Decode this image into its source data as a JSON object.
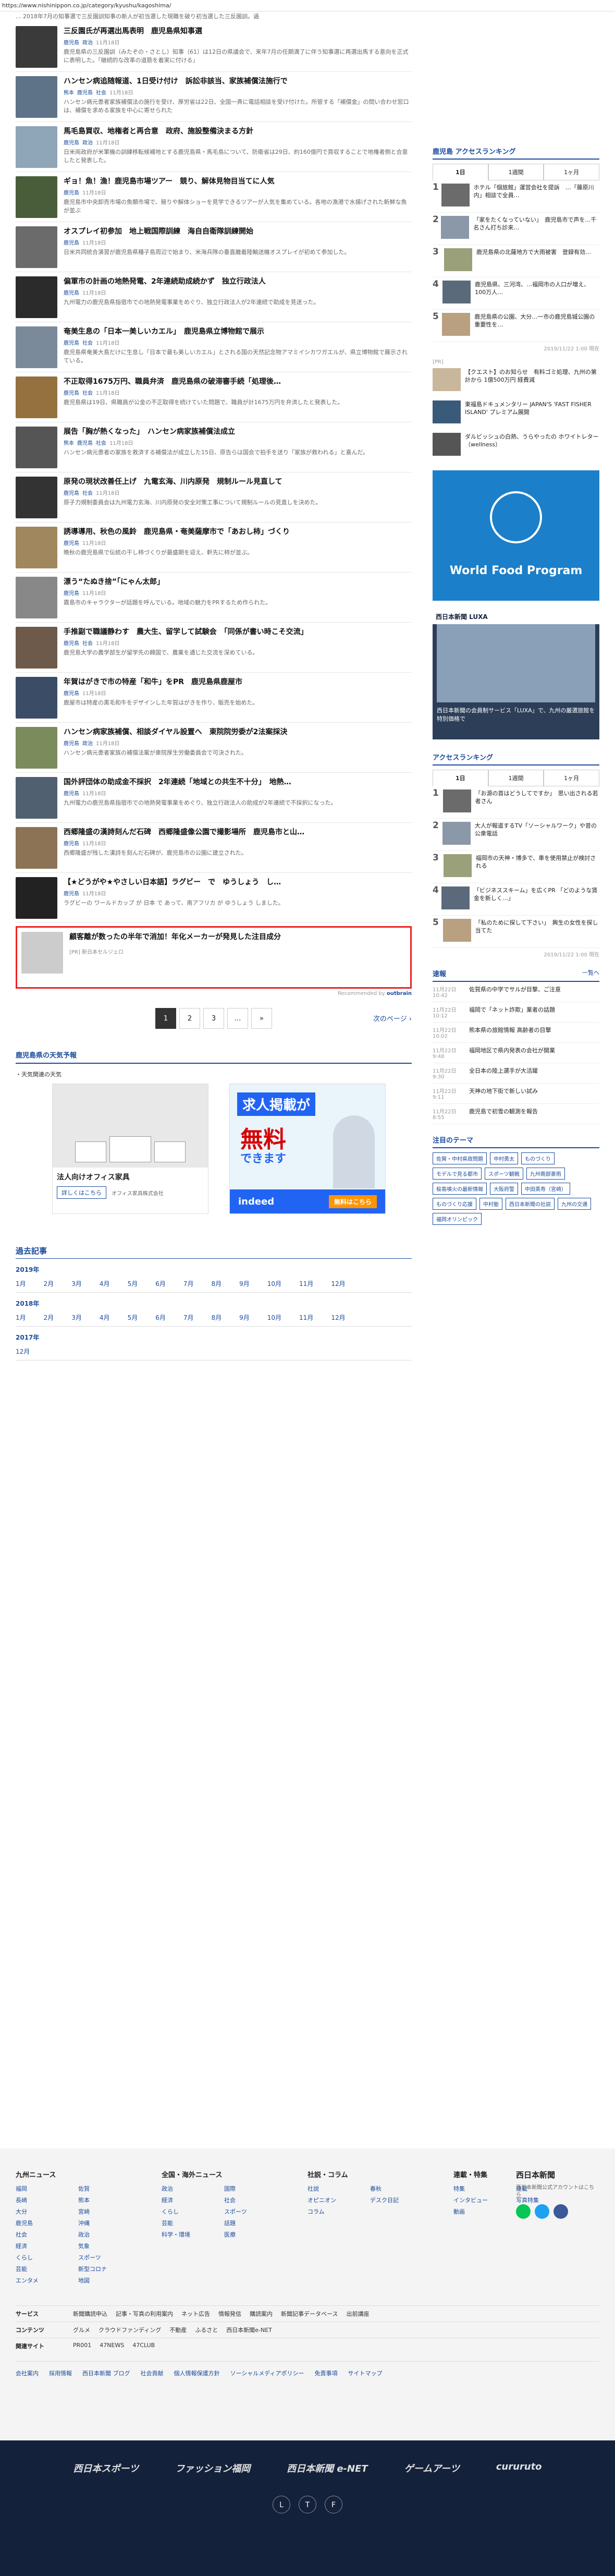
{
  "url": "https://www.nishinippon.co.jp/category/kyushu/kagoshima/",
  "top_snippet": "... 2018年7月の知事選で三反園訓知事の新人が初当選した現職を破り初当選した三反園訓。過",
  "articles": [
    {
      "title": "三反園氏が再選出馬表明　鹿児島県知事選",
      "tags": [
        "鹿児島",
        "政治"
      ],
      "time": "11月18日",
      "desc": "鹿児島県の三反園訓（みたぞの・さとし）知事（61）は12日の県議会で、来年7月の任期満了に伴う知事選に再選出馬する意向を正式に表明した。「継続的な改革の道筋を着実に付ける」"
    },
    {
      "title": "ハンセン病追随報道、1日受け付け　訴訟非該当、家族補償法施行で",
      "tags": [
        "熊本",
        "鹿児島",
        "社会"
      ],
      "time": "11月18日",
      "desc": "ハンセン病元患者家族補償法の施行を受け、厚労省は22日、全国一斉に電話相談を受け付けた。所管する「補償金」の問い合わせ窓口は、補償を求める家族を中心に寄せられた"
    },
    {
      "title": "馬毛島買収、地権者と再合意　政府、施設整備決まる方針",
      "tags": [
        "鹿児島",
        "政治"
      ],
      "time": "11月18日",
      "desc": "日米両政府が米軍機の訓練移転候補地とする鹿児島県・馬毛島について、防衛省は29日、約160億円で買収することで地権者側と合意したと発表した。"
    },
    {
      "title": "ギョ！魚！漁！鹿児島市場ツアー　競り、解体見物目当てに人気",
      "tags": [
        "鹿児島"
      ],
      "time": "11月18日",
      "desc": "鹿児島市中央卸売市場の魚類市場で、競りや解体ショーを見学できるツアーが人気を集めている。各地の漁港で水揚げされた新鮮な魚が並ぶ"
    },
    {
      "title": "オスプレイ初参加　地上戦国際訓練　海自自衛隊訓練開始",
      "tags": [
        "鹿児島"
      ],
      "time": "11月18日",
      "desc": "日米共同統合演習が鹿児島県種子島周辺で始まり、米海兵隊の垂直離着陸輸送機オスプレイが初めて参加した。"
    },
    {
      "title": "偏軍市の計画の地熱発電、2年連続助成続かず　独立行政法人",
      "tags": [
        "鹿児島"
      ],
      "time": "11月18日",
      "desc": "九州電力の鹿児島県指宿市での地熱発電事業をめぐり、独立行政法人が2年連続で助成を見送った。"
    },
    {
      "title": "奄美生息の「日本一美しいカエル」　鹿児島県立博物館で展示",
      "tags": [
        "鹿児島",
        "社会"
      ],
      "time": "11月18日",
      "desc": "鹿児島県奄美大島だけに生息し「日本で最も美しいカエル」とされる国の天然記念物アマミイシカワガエルが、県立博物館で展示されている。"
    },
    {
      "title": "不正取得1675万円、職員弁済　鹿児島県の破滞審手続「処理後…",
      "tags": [
        "鹿児島",
        "社会"
      ],
      "time": "11月18日",
      "desc": "鹿児島県は19日、県職員が公金の不正取得を続けていた問題で、職員が計1675万円を弁済したと発表した。"
    },
    {
      "title": "展告「胸が熱くなった」　ハンセン病家族補償法成立",
      "tags": [
        "熊本",
        "鹿児島",
        "社会"
      ],
      "time": "11月18日",
      "desc": "ハンセン病元患者の家族を救済する補償法が成立した15日、原告らは国会で拍手を送り「家族が救われる」と喜んだ。"
    },
    {
      "title": "原発の現状改善任上げ　九電玄海、川内原発　規制ルール見直して",
      "tags": [
        "鹿児島",
        "社会"
      ],
      "time": "11月18日",
      "desc": "原子力規制委員会は九州電力玄海、川内原発の安全対策工事について規制ルールの見直しを決めた。"
    },
    {
      "title": "誘導導用、秋色の風鈴　鹿児島県・奄美薩摩市で「あおし柿」づくり",
      "tags": [
        "鹿児島"
      ],
      "time": "11月18日",
      "desc": "晩秋の鹿児島県で伝統の干し柿づくりが最盛期を迎え、軒先に柿が並ぶ。"
    },
    {
      "title": "漂う“たぬき捨”「にゃん太郎」",
      "tags": [
        "鹿児島"
      ],
      "time": "11月18日",
      "desc": "霧島市のキャラクターが話題を呼んでいる。地域の魅力をPRするため作られた。"
    },
    {
      "title": "手推副で職議静わす　農大生、留学して試験会　「同係が書い時こそ交流」",
      "tags": [
        "鹿児島",
        "社会"
      ],
      "time": "11月18日",
      "desc": "鹿児島大学の農学部生が留学先の韓国で、農業を通じた交流を深めている。"
    },
    {
      "title": "年賀はがきで市の特産「和牛」をPR　鹿児島県鹿屋市",
      "tags": [
        "鹿児島"
      ],
      "time": "11月18日",
      "desc": "鹿屋市は特産の黒毛和牛をデザインした年賀はがきを作り、販売を始めた。"
    },
    {
      "title": "ハンセン病家族補償、相談ダイヤル設置へ　東院院労委が2法案採決",
      "tags": [
        "鹿児島",
        "政治"
      ],
      "time": "11月18日",
      "desc": "ハンセン病元患者家族の補償法案が衆院厚生労働委員会で可決された。"
    },
    {
      "title": "国外評団体の助成金不採択　2年連続「地域との共生不十分」　地熱…",
      "tags": [
        "鹿児島"
      ],
      "time": "11月18日",
      "desc": "九州電力の鹿児島県指宿市での地熱発電事業をめぐり、独立行政法人の助成が2年連続で不採択になった。"
    },
    {
      "title": "西郷隆盛の漢詩刻んだ石碑　西郷隆盛像公園で撮影場所　鹿児島市と山…",
      "tags": [
        "鹿児島"
      ],
      "time": "11月18日",
      "desc": "西郷隆盛が残した漢詩を刻んだ石碑が、鹿児島市の公園に建立された。"
    },
    {
      "title": "【★どうがや★やさしい日本語】ラグビー　で　ゆうしょう　し…",
      "tags": [
        "鹿児島"
      ],
      "time": "11月18日",
      "desc": "ラグビーの ワールドカップ が 日本 で あって、南アフリカ が ゆうしょう しました。"
    }
  ],
  "pr": {
    "title": "顧客離が数ったの半年で消加！年化メーカーが発見した注目成分",
    "sponsor": "[PR] 新日本セルジェロ"
  },
  "recommended": "Recommended by",
  "pager": {
    "pages": [
      "1",
      "2",
      "3",
      "…",
      "»"
    ],
    "next": "次のページ"
  },
  "ad_section": {
    "title": "鹿児島県の天気予報",
    "sub": "・天気関連の天気",
    "ad1_title": "法人向けオフィス家具",
    "ad1_btn": "詳しくはこちら",
    "ad1_co": "オフィス家具株式会社",
    "ad2_title": "求人掲載が",
    "ad2_big": "無料",
    "ad2_sub": "できます",
    "ad2_brand": "indeed",
    "ad2_btn": "無料はこちら"
  },
  "archive": {
    "title": "過去記事",
    "years": [
      {
        "year": "2019年",
        "months": [
          "1月",
          "2月",
          "3月",
          "4月",
          "5月",
          "6月",
          "7月",
          "8月",
          "9月",
          "10月",
          "11月",
          "12月"
        ]
      },
      {
        "year": "2018年",
        "months": [
          "1月",
          "2月",
          "3月",
          "4月",
          "5月",
          "6月",
          "7月",
          "8月",
          "9月",
          "10月",
          "11月",
          "12月"
        ]
      },
      {
        "year": "2017年",
        "months": [
          "12月"
        ]
      }
    ]
  },
  "side": {
    "rank_title": "鹿児島 アクセスランキング",
    "tabs": [
      "1日",
      "1週間",
      "1ヶ月"
    ],
    "ranking": [
      {
        "n": "1",
        "t": "ホテル「個旅館」運営会社を提訴　…「藤原川内」相談で全員…"
      },
      {
        "n": "2",
        "t": "「家をたくなっていない」　鹿児島市で声を…千名さん打ち診来…"
      },
      {
        "n": "3",
        "t": "鹿児島県の北薩地方で大雨被害　登録有効…"
      },
      {
        "n": "4",
        "t": "鹿児島県、三河湾、…福岡市の人口が増え、100万人…"
      },
      {
        "n": "5",
        "t": "鹿児島県の公園、大分…一市の鹿児島城公園の重要性を…"
      }
    ],
    "stamp1": "2019/11/22 1:00 現在",
    "pr_label": "[PR]",
    "pr_items": [
      {
        "t": "【クエスト】のお知らせ　有料ゴミ処理、九州の第計から 1億500万円 経費減"
      },
      {
        "t": "東福島ドキュメンタリー JAPAN'S 'FAST FISHER ISLAND' プレミアム展開"
      },
      {
        "t": "ダルビッシュの白熱、うらやったの ホワイトレター（wellness）"
      }
    ],
    "wfp": "World Food Program",
    "promo_brand": "西日本新聞 LUXA",
    "promo_text": "西日本新聞の会員制サービス「LUXA」で、九州の厳選旅館を特別価格で",
    "rank2_title": "アクセスランキング",
    "tabs2": [
      "1日",
      "1週間",
      "1ヶ月"
    ],
    "ranking2": [
      {
        "n": "1",
        "t": "「お源の首はどうしてですか」　思い出される若者さん"
      },
      {
        "n": "2",
        "t": "大人が報道するTV「ソーシャルワーク」や昔の公衆電話"
      },
      {
        "n": "3",
        "t": "福岡市の天神・博多で、車を使用禁止が検討される"
      },
      {
        "n": "4",
        "t": "「ビジネススキーム」を広くPR 「どのような賃金を新しく…」"
      },
      {
        "n": "5",
        "t": "「私のために探して下さい」　興生の女性を探し当てた"
      }
    ],
    "stamp2": "2019/11/22 1:00 現在",
    "latest_title": "速報",
    "latest_more": "一覧へ",
    "latest": [
      {
        "time": "11月22日 10:42",
        "t": "佐賀県の中学でサルが目撃、ご注意"
      },
      {
        "time": "11月22日 10:12",
        "t": "福岡で「ネット詐欺」業者の話題"
      },
      {
        "time": "11月22日 10:02",
        "t": "熊本県の旅館情報 高齢者の目撃"
      },
      {
        "time": "11月22日 9:48",
        "t": "福岡地区で県内発表の会社が開業"
      },
      {
        "time": "11月22日 9:30",
        "t": "全日本の陸上選手が大活躍"
      },
      {
        "time": "11月22日 9:11",
        "t": "天神の地下街で新しい試み"
      },
      {
        "time": "11月22日 8:55",
        "t": "鹿児島で初雪の観測を報告"
      }
    ],
    "theme_title": "注目のテーマ",
    "themes": [
      "佐賀・中村県政問題",
      "中村勇太",
      "ものづくり",
      "モデルで見る都市",
      "スポーツ観戦",
      "九州南部豪雨",
      "桜島噴火の最新情報",
      "大阪府警",
      "中田英寿（宮崎）",
      "ものづくり応援",
      "中村塾",
      "西日本新聞の社説",
      "九州の交通",
      "福岡オリンピック"
    ]
  },
  "footer": {
    "cols": [
      {
        "title": "九州ニュース",
        "items": [
          "福岡",
          "佐賀",
          "長崎",
          "熊本",
          "大分",
          "宮崎",
          "鹿児島",
          "沖縄",
          "社会",
          "政治",
          "経済",
          "気象",
          "くらし",
          "スポーツ",
          "芸能",
          "新型コロナ",
          "エンタメ",
          "地図"
        ]
      },
      {
        "title": "全国・海外ニュース",
        "items": [
          "政治",
          "国際",
          "経済",
          "社会",
          "くらし",
          "スポーツ",
          "芸能",
          "話題",
          "科学・環境",
          "医療"
        ]
      },
      {
        "title": "社説・コラム",
        "items": [
          "社説",
          "春秋",
          "オピニオン",
          "デスク日記",
          "コラム"
        ]
      },
      {
        "title": "連載・特集",
        "items": [
          "特集",
          "連載",
          "インタビュー",
          "写真特集",
          "動画"
        ]
      }
    ],
    "brand": "西日本新聞",
    "brand_note": "西日本新聞公式アカウントはこちら",
    "rows": [
      {
        "label": "サービス",
        "items": [
          "新聞購読申込",
          "記事・写真の利用案内",
          "ネット広告",
          "情報発信",
          "購読案内",
          "新聞記事データベース",
          "出前講座"
        ]
      },
      {
        "label": "コンテンツ",
        "items": [
          "グルメ",
          "クラウドファンディング",
          "不動産",
          "ふるさと",
          "西日本新聞e-NET"
        ]
      },
      {
        "label": "関連サイト",
        "items": [
          "PR001",
          "47NEWS",
          "47CLUB"
        ]
      }
    ],
    "links": [
      "会社案内",
      "採用情報",
      "西日本新聞 ブログ",
      "社会貢献",
      "個人情報保護方針",
      "ソーシャルメディアポリシー",
      "免責事項",
      "サイトマップ"
    ],
    "brands": [
      "西日本スポーツ",
      "ファッション福岡",
      "西日本新聞 e-NET",
      "ゲームアーツ",
      "cururuto"
    ],
    "social": [
      "LINE",
      "Twitter",
      "Facebook"
    ]
  },
  "colors": {
    "accent": "#1a4b9c",
    "pr_border": "#e22",
    "footer_dark": "#13213b",
    "wfp": "#1b7fc9"
  }
}
